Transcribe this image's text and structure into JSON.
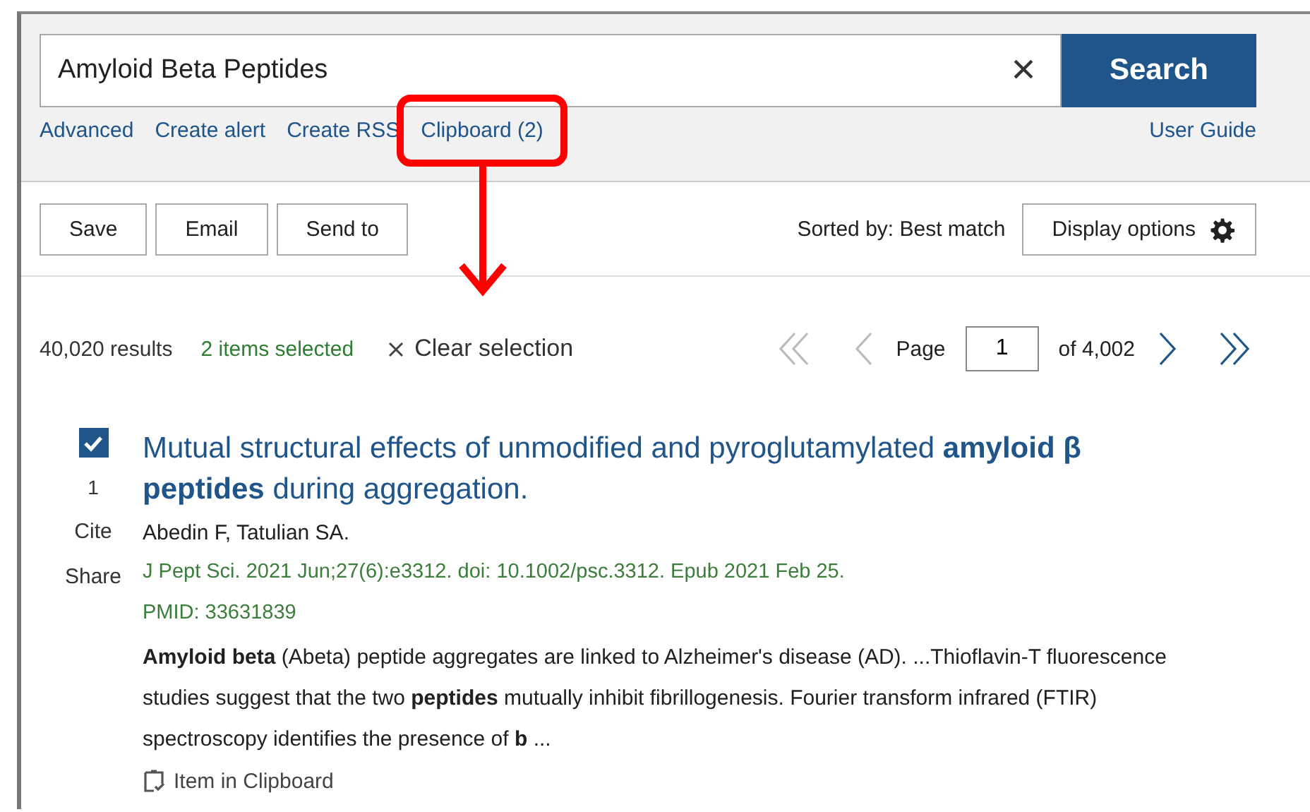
{
  "search": {
    "value": "Amyloid Beta Peptides",
    "clear_label": "×",
    "button": "Search"
  },
  "links": [
    {
      "label": "Advanced",
      "highlighted": false
    },
    {
      "label": "Create alert",
      "highlighted": false
    },
    {
      "label": "Create RSS",
      "highlighted": false
    },
    {
      "label": "Clipboard (2)",
      "highlighted": true
    }
  ],
  "user_guide": "User Guide",
  "actions": [
    "Save",
    "Email",
    "Send to"
  ],
  "sort": "Sorted by: Best match",
  "display_options": "Display options",
  "results": {
    "count": "40,020 results",
    "selected": "2 items selected",
    "clear_selection": "Clear selection"
  },
  "pagination": {
    "first_disabled": true,
    "prev_disabled": true,
    "label": "Page",
    "page": "1",
    "of": "of 4,002",
    "next_disabled": false,
    "last_disabled": false
  },
  "articles": [
    {
      "checked": true,
      "number": "1",
      "cite": "Cite",
      "share": "Share",
      "title": "Mutual structural effects of unmodified and pyroglutamylated **amyloid β peptides** during aggregation.",
      "authors": "Abedin F, Tatulian SA.",
      "citation": "J Pept Sci. 2021 Jun;27(6):e3312. doi: 10.1002/psc.3312. Epub 2021 Feb 25.",
      "pmid": "PMID: 33631839",
      "snippet": "**Amyloid beta** (Abeta) peptide aggregates are linked to Alzheimer's disease (AD). ...Thioflavin-T fluorescence studies suggest that the two **peptides** mutually inhibit fibrillogenesis. Fourier transform infrared (FTIR) spectroscopy identifies the presence of **b** ...",
      "clipboard_note": "Item in Clipboard"
    }
  ]
}
